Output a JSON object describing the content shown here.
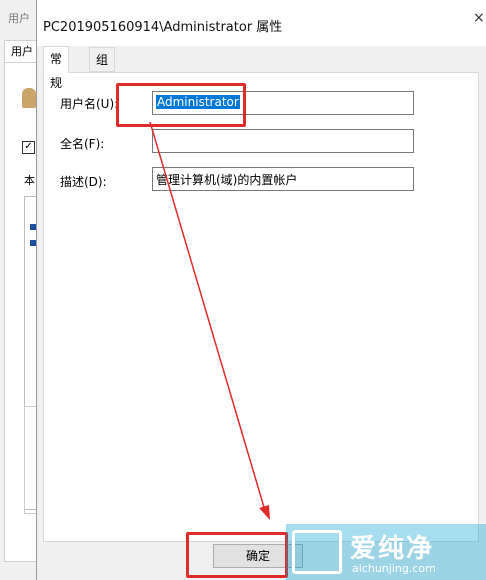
{
  "background_window": {
    "title": "用户",
    "tab_label": "用户",
    "checkbox_mark": "✓",
    "text": "本"
  },
  "dialog": {
    "title": "PC201905160914\\Administrator 属性",
    "close_glyph": "×",
    "tabs": [
      {
        "label": "常规",
        "active": true
      },
      {
        "label": "组成员",
        "active": false
      }
    ],
    "fields": [
      {
        "label": "用户名(U):",
        "value": "Administrator",
        "selected": true
      },
      {
        "label": "全名(F):",
        "value": ""
      },
      {
        "label": "描述(D):",
        "value": "管理计算机(域)的内置帐户"
      }
    ],
    "ok_label": "确定"
  },
  "annotation": {
    "color": "#e02b2b"
  },
  "watermark": {
    "text_cn": "爱纯净",
    "text_en": "aichunjing.com"
  }
}
